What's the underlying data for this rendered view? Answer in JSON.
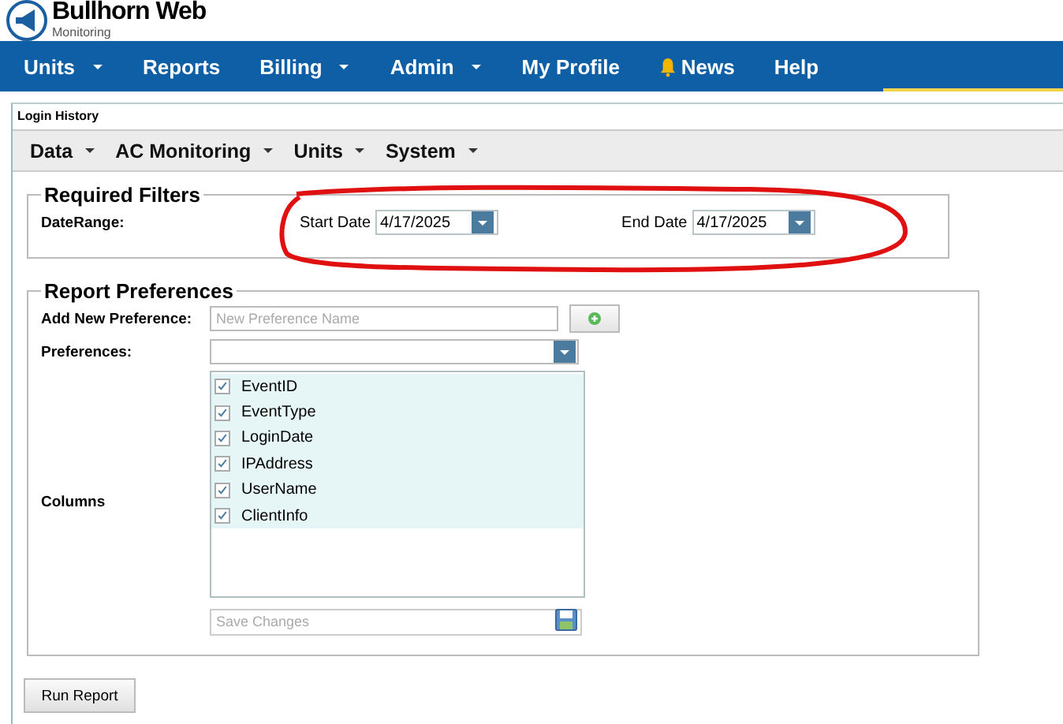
{
  "brand": {
    "title": "Bullhorn Web",
    "subtitle": "Monitoring"
  },
  "nav": [
    {
      "label": "Units",
      "dropdown": true,
      "kind": "link"
    },
    {
      "label": "Reports",
      "dropdown": false,
      "kind": "link"
    },
    {
      "label": "Billing",
      "dropdown": true,
      "kind": "link"
    },
    {
      "label": "Admin",
      "dropdown": true,
      "kind": "link"
    },
    {
      "label": "My Profile",
      "dropdown": false,
      "kind": "link"
    },
    {
      "label": "News",
      "dropdown": false,
      "kind": "alert"
    },
    {
      "label": "Help",
      "dropdown": false,
      "kind": "link"
    }
  ],
  "panel": {
    "title": "Login History",
    "menu": [
      {
        "label": "Data"
      },
      {
        "label": "AC Monitoring"
      },
      {
        "label": "Units"
      },
      {
        "label": "System"
      }
    ],
    "required_filters": {
      "legend": "Required Filters",
      "label": "DateRange:",
      "start_label": "Start Date",
      "start_value": "4/17/2025",
      "end_label": "End Date",
      "end_value": "4/17/2025"
    },
    "report_preferences": {
      "legend": "Report Preferences",
      "add_label": "Add New Preference:",
      "add_placeholder": "New Preference Name",
      "preferences_label": "Preferences:",
      "columns_label": "Columns",
      "columns": [
        {
          "label": "EventID",
          "checked": true
        },
        {
          "label": "EventType",
          "checked": true
        },
        {
          "label": "LoginDate",
          "checked": true
        },
        {
          "label": "IPAddress",
          "checked": true
        },
        {
          "label": "UserName",
          "checked": true
        },
        {
          "label": "ClientInfo",
          "checked": true
        }
      ],
      "save_placeholder": "Save Changes"
    },
    "run_button": "Run Report"
  }
}
